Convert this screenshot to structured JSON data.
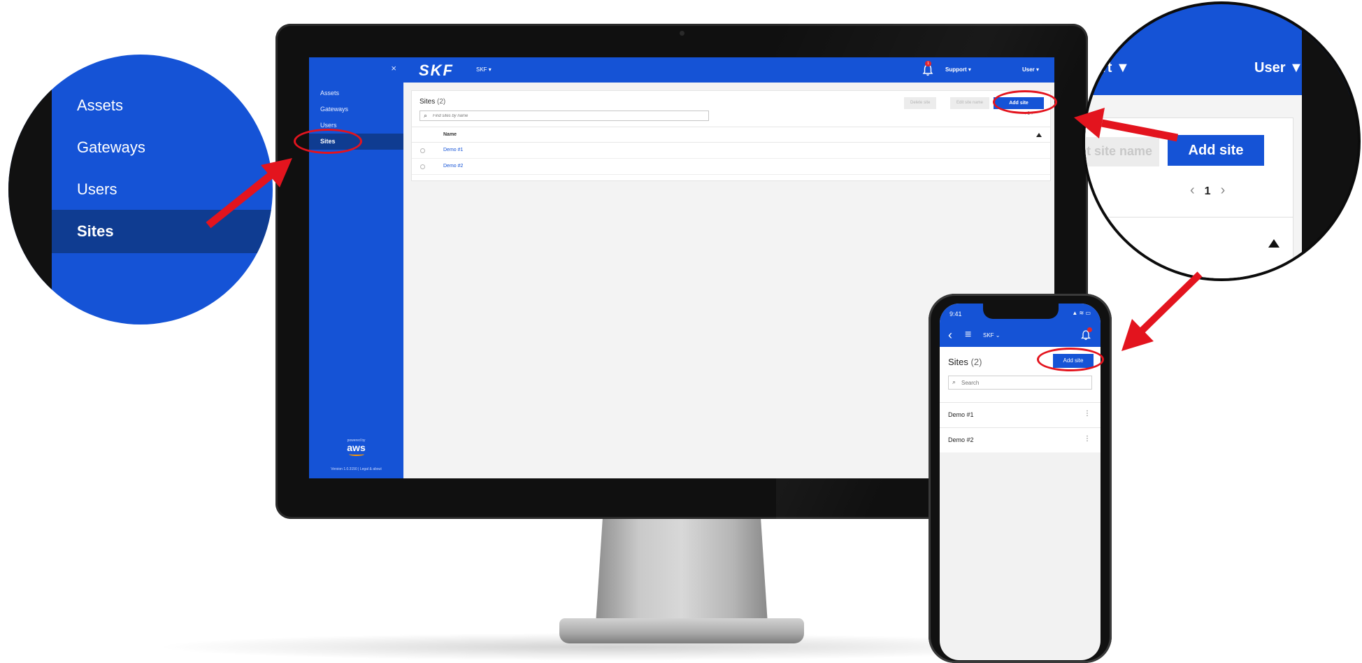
{
  "desktop": {
    "sidebar": {
      "items": [
        {
          "label": "Assets"
        },
        {
          "label": "Gateways"
        },
        {
          "label": "Users"
        },
        {
          "label": "Sites"
        }
      ],
      "close_glyph": "×",
      "aws_caption": "powered by",
      "aws_logo": "aws",
      "version": "Version 1.0.3150 | Legal & about"
    },
    "header": {
      "logo": "SKF",
      "org": "SKF ▾",
      "support": "Support ▾",
      "user": "User ▾",
      "notification_count": "1"
    },
    "sites": {
      "title": "Sites",
      "count": "(2)",
      "search_placeholder": "Find sites by name",
      "delete_label": "Delete site",
      "edit_label": "Edit site name",
      "add_label": "Add site",
      "pager": "‹ 1 ›",
      "column_name": "Name",
      "rows": [
        {
          "name": "Demo #1"
        },
        {
          "name": "Demo #2"
        }
      ]
    }
  },
  "zoom_left": {
    "items": [
      "Assets",
      "Gateways",
      "Users",
      "Sites"
    ]
  },
  "zoom_right": {
    "support": "rt ▼",
    "user": "User ▼",
    "edit_partial": "t site name",
    "add_label": "Add site",
    "page_prev": "‹",
    "page_num": "1",
    "page_next": "›"
  },
  "phone": {
    "time": "9:41",
    "status_icons": "▲ ≋ ▭",
    "org": "SKF ⌄",
    "title": "Sites",
    "count": "(2)",
    "add_label": "Add site",
    "search_placeholder": "Search",
    "rows": [
      {
        "name": "Demo #1"
      },
      {
        "name": "Demo #2"
      }
    ]
  },
  "colors": {
    "brand_blue": "#1553d6",
    "sidebar_active": "#0f3c91",
    "annotation_red": "#e3141e"
  }
}
